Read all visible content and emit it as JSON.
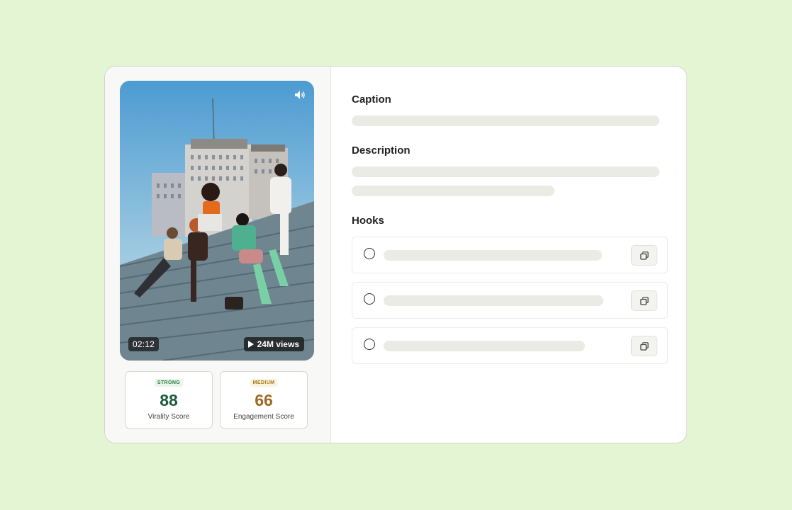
{
  "video": {
    "duration": "02:12",
    "views": "24M views"
  },
  "scores": [
    {
      "badge": "STRONG",
      "value": "88",
      "label": "Virality Score"
    },
    {
      "badge": "MEDIUM",
      "value": "66",
      "label": "Engagement Score"
    }
  ],
  "sections": {
    "caption": "Caption",
    "description": "Description",
    "hooks": "Hooks"
  },
  "colors": {
    "page_background": "#e3f5d2",
    "strong_score": "#1f5c3d",
    "medium_score": "#9a6a20",
    "skeleton": "#ebebe6"
  },
  "icons": [
    "sound-icon",
    "play-icon",
    "radio-icon",
    "copy-icon"
  ]
}
